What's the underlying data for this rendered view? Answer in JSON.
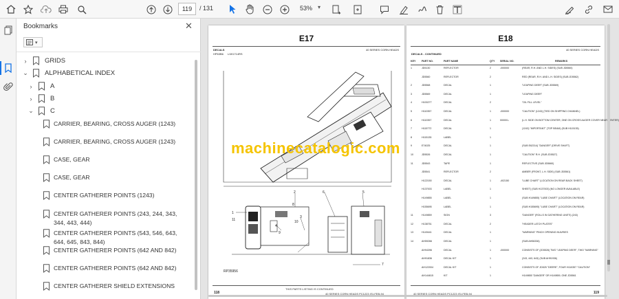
{
  "toolbar": {
    "current_page": "119",
    "total_pages": "/ 131",
    "zoom": "53%"
  },
  "bookmarks": {
    "title": "Bookmarks",
    "items": [
      {
        "label": "GRIDS",
        "state": "collapsed",
        "level": 0
      },
      {
        "label": "ALPHABETICAL INDEX",
        "state": "expanded",
        "level": 0
      },
      {
        "label": "A",
        "state": "collapsed",
        "level": 1
      },
      {
        "label": "B",
        "state": "collapsed",
        "level": 1
      },
      {
        "label": "C",
        "state": "expanded",
        "level": 1
      }
    ],
    "leaves": [
      "CARRIER, BEARING, CROSS AUGER (1243)",
      "CARRIER, BEARING, CROSS AUGER (1243)",
      "CASE, GEAR",
      "CASE, GEAR",
      "CENTER GATHERER POINTS  (1243)",
      "CENTER GATHERER POINTS  (243, 244, 343, 344, 443, 444)",
      "CENTER GATHERER POINTS  (543, 546, 643, 644, 645, 843, 844)",
      "CENTER GATHERER POINTS  (642 AND 842)",
      "CENTER GATHERER POINTS  (642 AND 842)",
      "CENTER GATHERER SHIELD EXTENSIONS"
    ]
  },
  "document": {
    "left_page": {
      "heading": "E17",
      "section": "DECALS",
      "header_right": "40 SERIES CORN HEADS",
      "code": "HP63B6",
      "code2": "L/W1714RS",
      "figure_id": "RP35956",
      "callouts": [
        "1",
        "2",
        "3",
        "4",
        "5",
        "6",
        "7",
        "8",
        "9",
        "10",
        "11"
      ],
      "footer": "THIS PARTS LISTING IS CONTINUED",
      "footer2": "40 SERIES CORN HEADS  PC1223  (S)-FEB-94",
      "page_number": "118"
    },
    "right_page": {
      "heading": "E18",
      "header_right": "40 SERIES CORN HEADS",
      "section": "DECALS - CONTINUED",
      "columns": [
        "KEY",
        "PART NO.",
        "PART NAME",
        "QTY",
        "SERIAL NO.",
        "REMARKS"
      ],
      "rows": [
        {
          "key": "1",
          "part": "JD5130",
          "name": "REFLECTOR",
          "qty": "2",
          "serial": "-000000",
          "remarks": "(REAR, R.H. AND L.H. SIDES) (SUB JD5560)"
        },
        {
          "key": "",
          "part": "JD5560",
          "name": "REFLECTOR",
          "qty": "2",
          "serial": "",
          "remarks": "RED (REAR, R.H. AND L.H. SIDES) (SUB JD5562)"
        },
        {
          "key": "2",
          "part": "JD5568",
          "name": "DECAL",
          "qty": "1",
          "serial": "",
          "remarks": "\"LEAPING DEER\" (SUB JD5569)"
        },
        {
          "key": "3",
          "part": "JD5569",
          "name": "DECAL",
          "qty": "1",
          "serial": "",
          "remarks": "\"LEAPING DEER\""
        },
        {
          "key": "4",
          "part": "H100277",
          "name": "DECAL",
          "qty": "2",
          "serial": "",
          "remarks": "\"OIL FILL LEVEL\""
        },
        {
          "key": "5",
          "part": "H110357",
          "name": "DECAL",
          "qty": "1",
          "serial": "-000000",
          "remarks": "\"CAUTION\" (1243) (TIED ON SHIPPING CHANNEL)"
        },
        {
          "key": "6",
          "part": "H110357",
          "name": "DECAL",
          "qty": "1",
          "serial": "000001-",
          "remarks": "(L.H. SIDE ON BOTTOM CENTER, ONE ON CROSS AUGER COVER NEAR CENTER)"
        },
        {
          "key": "7",
          "part": "H115772",
          "name": "DECAL",
          "qty": "1",
          "serial": "",
          "remarks": "(1243) \"IMPORTANT\" (TOP BEAM) (SUB H115135)"
        },
        {
          "key": "8",
          "part": "H115135",
          "name": "LABEL",
          "qty": "1",
          "serial": "",
          "remarks": ""
        },
        {
          "key": "9",
          "part": "E74025",
          "name": "DECAL",
          "qty": "1",
          "serial": "",
          "remarks": "(SUB E62314) \"DANGER\" (DRIVE SHAFT)"
        },
        {
          "key": "10",
          "part": "JD5526",
          "name": "DECAL",
          "qty": "1",
          "serial": "",
          "remarks": "\"CAUTION\" R.H. (SUB JD5527)"
        },
        {
          "key": "11",
          "part": "JD5543",
          "name": "TAPE",
          "qty": "1",
          "serial": "",
          "remarks": "REFLECTIVE (SUB JD5660)"
        },
        {
          "key": "",
          "part": "JD5541",
          "name": "REFLECTOR",
          "qty": "2",
          "serial": "",
          "remarks": "AMBER (FRONT, L.H. SIDE) (SUB JD5561)"
        },
        {
          "key": "",
          "part": "H122150",
          "name": "DECAL",
          "qty": "1",
          "serial": "-402150",
          "remarks": "\"LUBE CHART\" (LOCATION ON REAR BACK SHEET)"
        },
        {
          "key": "",
          "part": "H137003",
          "name": "LABEL",
          "qty": "1",
          "serial": "",
          "remarks": "SHEET) (SUB H137003) (NO LONGER AVAILABLE)"
        },
        {
          "key": "",
          "part": "H149855",
          "name": "LABEL",
          "qty": "1",
          "serial": "",
          "remarks": "(SUB H149855) \"LUBE CHART\" (LOCATION ON REAR)"
        },
        {
          "key": "",
          "part": "H155695",
          "name": "LABEL",
          "qty": "1",
          "serial": "",
          "remarks": "(SUB H155695) \"LUBE CHART\" (LOCATION ON REAR)"
        },
        {
          "key": "11",
          "part": "H149859",
          "name": "SIGN",
          "qty": "3",
          "serial": "",
          "remarks": "\"DANGER\" (ROLLS IN GATHERING UNITS) (243)"
        },
        {
          "key": "12",
          "part": "H138751",
          "name": "DECAL",
          "qty": "2",
          "serial": "",
          "remarks": "\"HEADER LATCH PLATES\""
        },
        {
          "key": "13",
          "part": "H149441",
          "name": "DECAL",
          "qty": "1",
          "serial": "",
          "remarks": "\"WARNING\" PINCH OPENING INJURIES"
        },
        {
          "key": "14",
          "part": "AH59266",
          "name": "DECAL",
          "qty": "1",
          "serial": "",
          "remarks": "(SUB AH56336)"
        },
        {
          "key": "",
          "part": "AH94396",
          "name": "DECAL",
          "qty": "1",
          "serial": "-000000",
          "remarks": "CONSISTS OF (JD5526) TWO \"LEAPING DEER\", TWO \"WARNING\""
        },
        {
          "key": "",
          "part": "AH91836",
          "name": "DECAL KIT",
          "qty": "1",
          "serial": "",
          "remarks": "(243, 443, 643) (SUB AH91936)"
        },
        {
          "key": "",
          "part": "AH122004",
          "name": "DECAL KIT",
          "qty": "1",
          "serial": "",
          "remarks": "CONSISTS OF JD525 \"DEERE\", FOUR H110357 \"CAUTION\""
        },
        {
          "key": "",
          "part": "AH144615",
          "name": "KIT",
          "qty": "1",
          "serial": "",
          "remarks": "H149855 \"DANGER\" OR H149859, ONE JD5561"
        }
      ],
      "footer": "40 SERIES CORN HEADS  PC1223  (S)-FEB-94",
      "footer2": "Printed in U.S.A.",
      "page_number": "119"
    }
  },
  "watermark": "machinecatalogic.com",
  "colors": {
    "accent": "#1473e6",
    "watermark": "#f5c400"
  }
}
